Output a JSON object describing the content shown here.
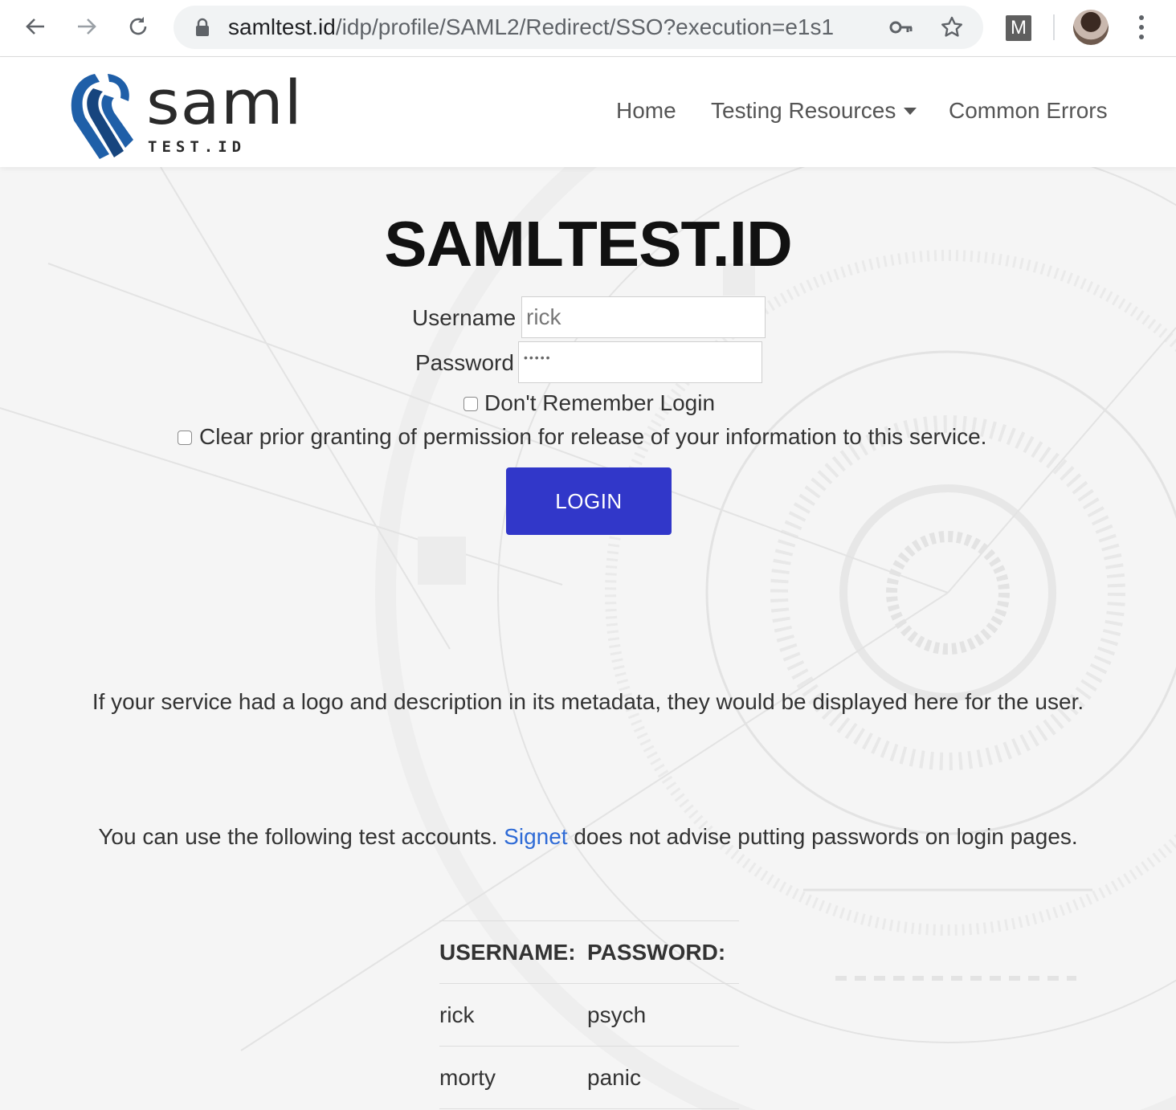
{
  "browser": {
    "url_host": "samltest.id",
    "url_path": "/idp/profile/SAML2/Redirect/SSO?execution=e1s1",
    "extension_label": "M"
  },
  "site": {
    "logo_word": "saml",
    "logo_sub": "TEST.ID",
    "nav": {
      "home": "Home",
      "testing_resources": "Testing Resources",
      "common_errors": "Common Errors"
    }
  },
  "login": {
    "title": "SAMLTEST.ID",
    "username_label": "Username",
    "username_value": "rick",
    "password_label": "Password",
    "password_mask": "•••••",
    "dont_remember_label": "Don't Remember Login",
    "clear_consent_label": "Clear prior granting of permission for release of your information to this service.",
    "login_button": "LOGIN"
  },
  "info": {
    "service_note": "If your service had a logo and description in its metadata, they would be displayed here for the user.",
    "accounts_intro_before": "You can use the following test accounts.",
    "accounts_intro_link": "Signet",
    "accounts_intro_after": "does not advise putting passwords on login pages."
  },
  "accounts": {
    "headers": [
      "USERNAME:",
      "PASSWORD:"
    ],
    "rows": [
      [
        "rick",
        "psych"
      ],
      [
        "morty",
        "panic"
      ]
    ]
  },
  "colors": {
    "login_button": "#3137c9",
    "link": "#2f6bd6",
    "logo_blue": "#1f5fa8"
  }
}
